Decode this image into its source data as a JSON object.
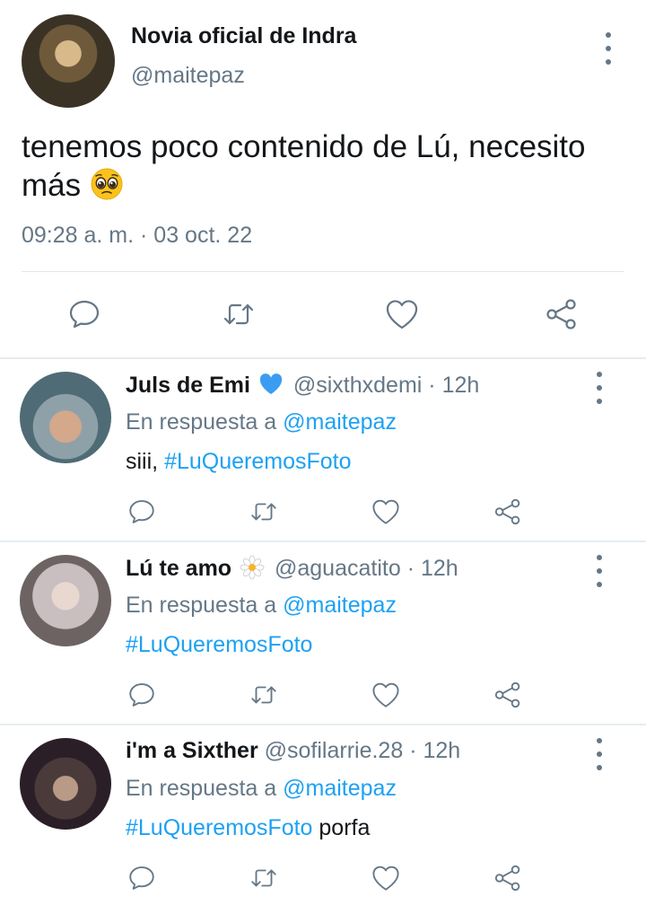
{
  "main_tweet": {
    "name": "Novia oficial de Indra",
    "handle": "@maitepaz",
    "text": "tenemos poco contenido de Lú, necesito más",
    "emoji": "pleading-face-emoji",
    "timestamp": "09:28 a. m. · 03 oct. 22"
  },
  "reply_prefix": "En respuesta a",
  "replies": [
    {
      "name": "Juls de Emi",
      "badge": "blue-heart-icon",
      "handle": "@sixthxdemi",
      "time": "· 12h",
      "replying_to": "@maitepaz",
      "text_before": "siii, ",
      "hashtag": "#LuQueremosFoto",
      "text_after": ""
    },
    {
      "name": "Lú te amo",
      "badge": "daisy-flower-icon",
      "handle": "@aguacatito",
      "time": "· 12h",
      "replying_to": "@maitepaz",
      "text_before": "",
      "hashtag": "#LuQueremosFoto",
      "text_after": ""
    },
    {
      "name": "i'm a Sixther",
      "badge": "",
      "handle": "@sofilarrie.28",
      "time": "· 12h",
      "replying_to": "@maitepaz",
      "text_before": "",
      "hashtag": "#LuQueremosFoto",
      "text_after": " porfa"
    }
  ],
  "icons": {
    "reply": "speech-bubble-icon",
    "retweet": "retweet-icon",
    "like": "heart-icon",
    "share": "share-icon",
    "more": "vertical-ellipsis-icon"
  },
  "colors": {
    "text": "#14171a",
    "muted": "#657786",
    "link": "#1da1f2",
    "divider": "#e1e8ed"
  }
}
